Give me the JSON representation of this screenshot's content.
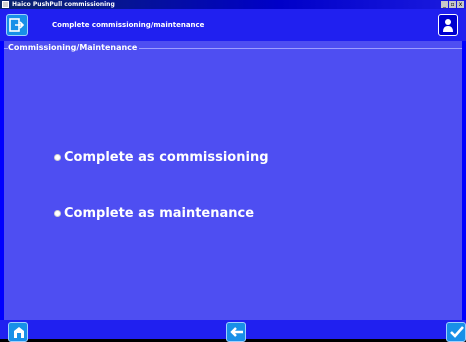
{
  "window": {
    "title": "Haico PushPull commissioning",
    "controls": [
      "_",
      "▫",
      "x"
    ]
  },
  "header": {
    "title": "Complete commissioning/maintenance",
    "exit_icon": "exit-icon",
    "user_icon": "user-icon"
  },
  "section": {
    "label": "Commissioning/Maintenance"
  },
  "options": [
    {
      "label": "Complete as commissioning",
      "selected": false
    },
    {
      "label": "Complete as maintenance",
      "selected": false
    }
  ],
  "footer": {
    "left_icon": "home-icon",
    "center_icon": "back-arrow-icon",
    "right_icon": "checkmark-icon"
  },
  "colors": {
    "background": "#4e4ef2",
    "bar": "#2020f0",
    "button": "#1890e8"
  }
}
